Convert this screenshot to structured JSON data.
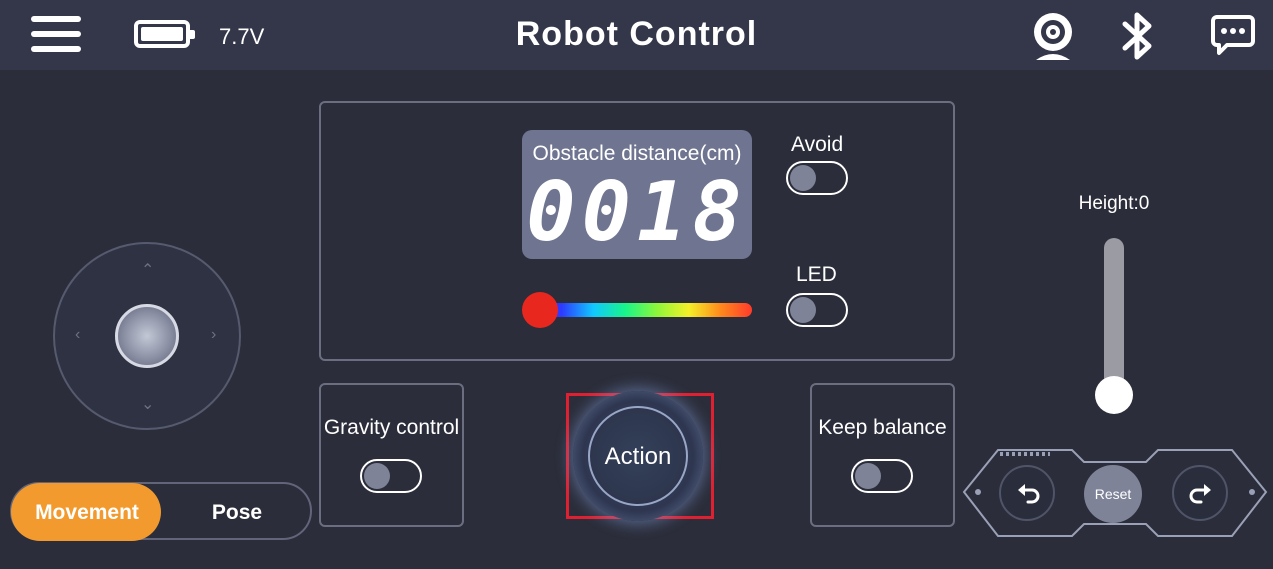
{
  "header": {
    "title": "Robot Control",
    "voltage": "7.7V",
    "icons": [
      "menu-icon",
      "battery-icon",
      "camera-icon",
      "bluetooth-icon",
      "chat-icon"
    ]
  },
  "display": {
    "obstacle_label": "Obstacle distance(cm)",
    "obstacle_value": "0018",
    "avoid_label": "Avoid",
    "avoid_on": false,
    "led_label": "LED",
    "led_on": false,
    "color_slider_position": 0
  },
  "controls": {
    "gravity_label": "Gravity control",
    "gravity_on": false,
    "action_label": "Action",
    "balance_label": "Keep balance",
    "balance_on": false
  },
  "modes": {
    "movement": "Movement",
    "pose": "Pose",
    "active": "Movement"
  },
  "height": {
    "label": "Height:0",
    "value": 0
  },
  "rotation": {
    "reset_label": "Reset",
    "left_icon": "rotate-left-icon",
    "right_icon": "rotate-right-icon"
  },
  "colors": {
    "accent": "#f29a2e",
    "highlight": "#e02030",
    "background": "#2b2d3a",
    "topbar": "#34374a"
  }
}
